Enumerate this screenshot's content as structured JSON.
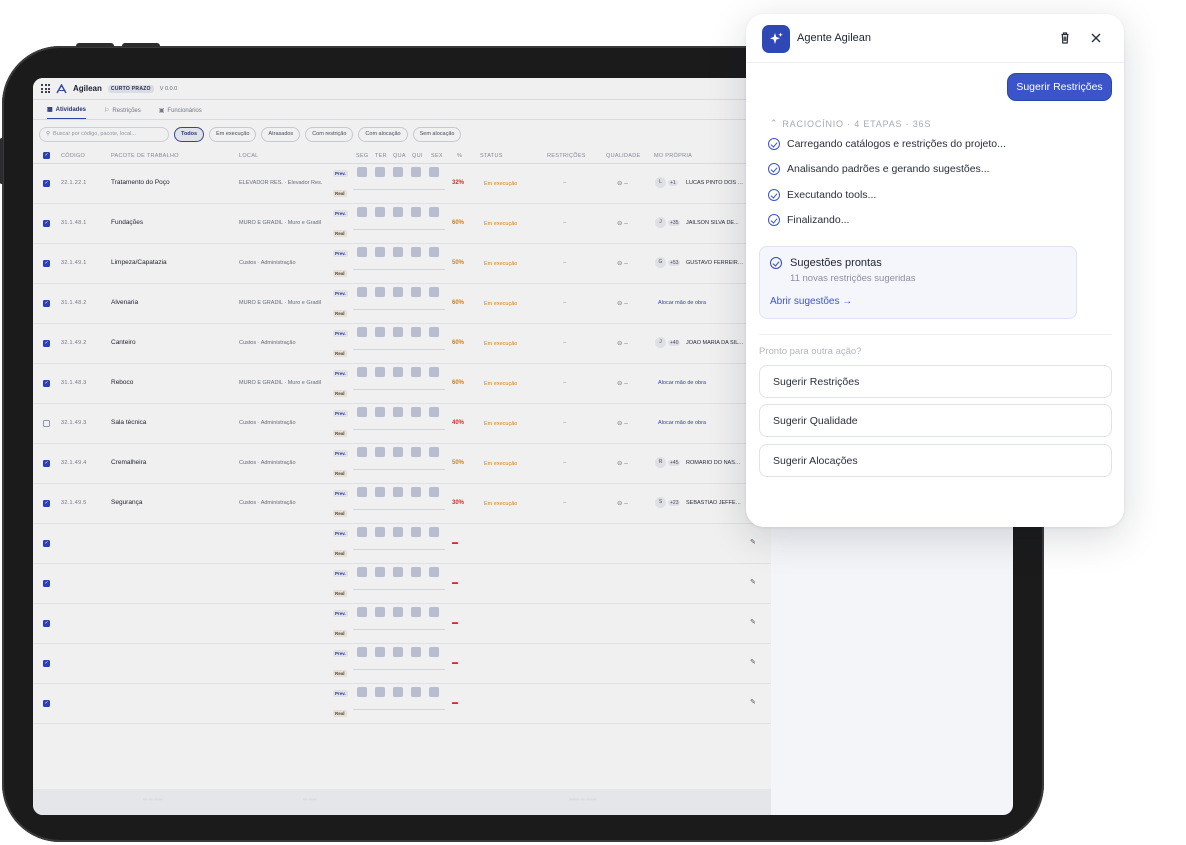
{
  "app": {
    "name": "Agilean",
    "badge": "CURTO PRAZO",
    "version": "V 0.0.0",
    "tabs": [
      {
        "label": "Atividades",
        "icon": "calendar-icon"
      },
      {
        "label": "Restrições",
        "icon": "flag-icon"
      },
      {
        "label": "Funcionários",
        "icon": "briefcase-icon"
      }
    ],
    "search_placeholder": "Buscar por código, pacote, local...",
    "filters": [
      "Todos",
      "Em execução",
      "Atrasados",
      "Com restrição",
      "Com alocação",
      "Sem alocação"
    ],
    "columns": {
      "code": "CÓDIGO",
      "package": "PACOTE DE TRABALHO",
      "location": "LOCAL",
      "seg": "SEG",
      "ter": "TER",
      "qua": "QUA",
      "qui": "QUI",
      "sex": "SEX",
      "pct": "%",
      "status": "STATUS",
      "restrictions": "RESTRIÇÕES",
      "quality": "QUALIDADE",
      "labor": "MO PRÓPRIA"
    },
    "prev_label": "Prev.",
    "real_label": "Real",
    "rows": [
      {
        "checked": true,
        "code": "22.1.22.1",
        "package": "Tratamento do Poço",
        "location": "ELEVADOR RES. · Elevador Res.",
        "pct": "32%",
        "pct_color": "#e0312a",
        "status": "Em execução",
        "restrictions": "–",
        "quality": "⊖ –",
        "avatar": "L",
        "more": "+1",
        "person": "LUCAS PINTO DOS S..."
      },
      {
        "checked": true,
        "code": "31.1.48.1",
        "package": "Fundações",
        "location": "MURO E GRADIL · Muro e Gradil",
        "pct": "60%",
        "pct_color": "#e08a1e",
        "status": "Em execução",
        "restrictions": "–",
        "quality": "⊖ –",
        "avatar": "J",
        "more": "+35",
        "person": "JAILSON SILVA DE..."
      },
      {
        "checked": true,
        "code": "32.1.49.1",
        "package": "Limpeza/Capatazia",
        "location": "Custos · Administração",
        "pct": "50%",
        "pct_color": "#e08a1e",
        "status": "Em execução",
        "restrictions": "–",
        "quality": "⊖ –",
        "avatar": "G",
        "more": "+53",
        "person": "GUSTAVO FERREIRA I..."
      },
      {
        "checked": true,
        "code": "31.1.48.2",
        "package": "Alvenaria",
        "location": "MURO E GRADIL · Muro e Gradil",
        "pct": "60%",
        "pct_color": "#e08a1e",
        "status": "Em execução",
        "restrictions": "–",
        "quality": "⊖ –",
        "alloc": "Alocar mão de obra"
      },
      {
        "checked": true,
        "code": "32.1.49.2",
        "package": "Canteiro",
        "location": "Custos · Administração",
        "pct": "60%",
        "pct_color": "#e08a1e",
        "status": "Em execução",
        "restrictions": "–",
        "quality": "⊖ –",
        "avatar": "J",
        "more": "+40",
        "person": "JOAO MARIA DA SILV..."
      },
      {
        "checked": true,
        "code": "31.1.48.3",
        "package": "Reboco",
        "location": "MURO E GRADIL · Muro e Gradil",
        "pct": "60%",
        "pct_color": "#e08a1e",
        "status": "Em execução",
        "restrictions": "–",
        "quality": "⊖ –",
        "alloc": "Alocar mão de obra"
      },
      {
        "checked": false,
        "code": "32.1.49.3",
        "package": "Sala técnica",
        "location": "Custos · Administração",
        "pct": "40%",
        "pct_color": "#e0312a",
        "status": "Em execução",
        "restrictions": "–",
        "quality": "⊖ –",
        "alloc": "Alocar mão de obra"
      },
      {
        "checked": true,
        "code": "32.1.49.4",
        "package": "Cremalheira",
        "location": "Custos · Administração",
        "pct": "50%",
        "pct_color": "#e08a1e",
        "status": "Em execução",
        "restrictions": "–",
        "quality": "⊖ –",
        "avatar": "R",
        "more": "+45",
        "person": "ROMARIO DO NASCI..."
      },
      {
        "checked": true,
        "code": "32.1.49.5",
        "package": "Segurança",
        "location": "Custos · Administração",
        "pct": "30%",
        "pct_color": "#e0312a",
        "status": "Em execução",
        "restrictions": "–",
        "quality": "⊖ –",
        "avatar": "S",
        "more": "+23",
        "person": "SEBASTIAO JEFFERS..."
      }
    ]
  },
  "agent": {
    "title": "Agente Agilean",
    "primary_button": "Sugerir Restrições",
    "reasoning_header": "RACIOCÍNIO · 4 ETAPAS · 36S",
    "steps": [
      "Carregando catálogos e restrições do projeto...",
      "Analisando padrões e gerando sugestões...",
      "Executando tools...",
      "Finalizando..."
    ],
    "ready_title": "Sugestões prontas",
    "ready_subtitle": "11 novas restrições sugeridas",
    "ready_link": "Abrir sugestões →",
    "next_prompt": "Pronto para outra ação?",
    "actions": [
      "Sugerir Restrições",
      "Sugerir Qualidade",
      "Sugerir Alocações"
    ],
    "accent_color": "#3b55c9"
  }
}
